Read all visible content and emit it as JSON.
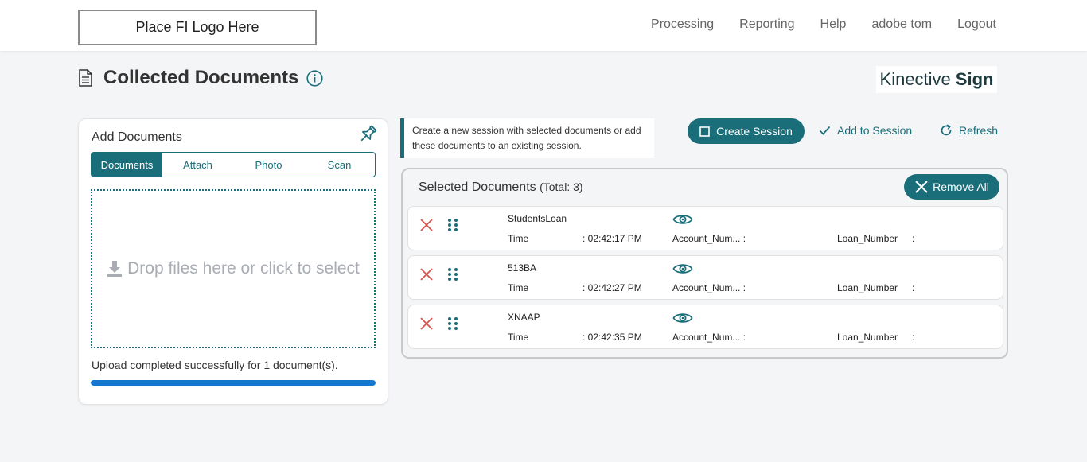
{
  "header": {
    "logo_text": "Place FI Logo Here",
    "nav": [
      "Processing",
      "Reporting",
      "Help",
      "adobe tom",
      "Logout"
    ]
  },
  "page": {
    "title": "Collected Documents",
    "brand_light": "Kinective",
    "brand_bold": "Sign"
  },
  "add_documents": {
    "title": "Add Documents",
    "tabs": [
      "Documents",
      "Attach",
      "Photo",
      "Scan"
    ],
    "active_tab": "Documents",
    "dropzone_text": "Drop files here or click to select",
    "upload_message": "Upload completed successfully for 1 document(s).",
    "progress_fraction": 1.0
  },
  "note": {
    "text": "Create a new session with selected documents or add these documents to an existing session."
  },
  "actions": {
    "create_session": "Create Session",
    "add_to_session": "Add to Session",
    "refresh": "Refresh"
  },
  "selected": {
    "title": "Selected Documents",
    "total_label": "(Total: 3)",
    "remove_all": "Remove All",
    "time_label": "Time",
    "account_label": "Account_Num... :",
    "loan_label": "Loan_Number",
    "loan_sep": ":",
    "docs": [
      {
        "name": "StudentsLoan",
        "time": ": 02:42:17 PM"
      },
      {
        "name": "513BA",
        "time": ": 02:42:27 PM"
      },
      {
        "name": "XNAAP",
        "time": ": 02:42:35 PM"
      }
    ]
  },
  "colors": {
    "accent": "#1a6e7a",
    "progress": "#1377d0",
    "danger": "#d9534f"
  }
}
